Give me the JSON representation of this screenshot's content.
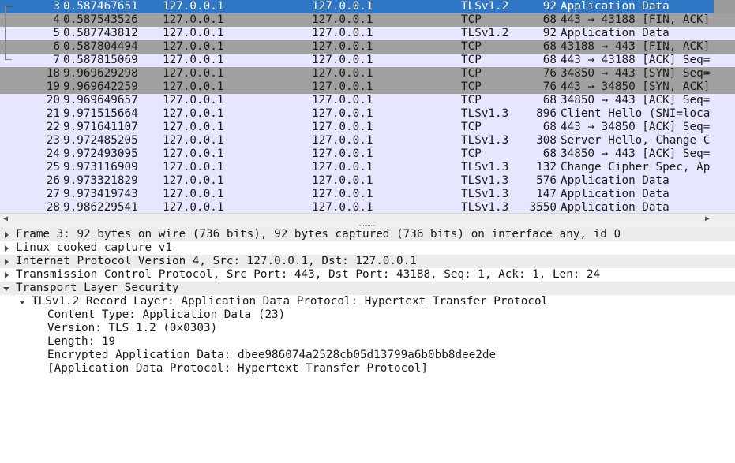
{
  "packet_list": {
    "rows": [
      {
        "no": "3",
        "time": "0.587467651",
        "src": "127.0.0.1",
        "dst": "127.0.0.1",
        "proto": "TLSv1.2",
        "len": "92",
        "info": "Application Data",
        "style": "sel"
      },
      {
        "no": "4",
        "time": "0.587543526",
        "src": "127.0.0.1",
        "dst": "127.0.0.1",
        "proto": "TCP",
        "len": "68",
        "info": "443 → 43188 [FIN, ACK]",
        "style": "fin"
      },
      {
        "no": "5",
        "time": "0.587743812",
        "src": "127.0.0.1",
        "dst": "127.0.0.1",
        "proto": "TLSv1.2",
        "len": "92",
        "info": "Application Data",
        "style": "tls"
      },
      {
        "no": "6",
        "time": "0.587804494",
        "src": "127.0.0.1",
        "dst": "127.0.0.1",
        "proto": "TCP",
        "len": "68",
        "info": "43188 → 443 [FIN, ACK]",
        "style": "fin"
      },
      {
        "no": "7",
        "time": "0.587815069",
        "src": "127.0.0.1",
        "dst": "127.0.0.1",
        "proto": "TCP",
        "len": "68",
        "info": "443 → 43188 [ACK] Seq=",
        "style": "tcp"
      },
      {
        "no": "18",
        "time": "9.969629298",
        "src": "127.0.0.1",
        "dst": "127.0.0.1",
        "proto": "TCP",
        "len": "76",
        "info": "34850 → 443 [SYN] Seq=",
        "style": "syn"
      },
      {
        "no": "19",
        "time": "9.969642259",
        "src": "127.0.0.1",
        "dst": "127.0.0.1",
        "proto": "TCP",
        "len": "76",
        "info": "443 → 34850 [SYN, ACK]",
        "style": "syn"
      },
      {
        "no": "20",
        "time": "9.969649657",
        "src": "127.0.0.1",
        "dst": "127.0.0.1",
        "proto": "TCP",
        "len": "68",
        "info": "34850 → 443 [ACK] Seq=",
        "style": "tcp"
      },
      {
        "no": "21",
        "time": "9.971515664",
        "src": "127.0.0.1",
        "dst": "127.0.0.1",
        "proto": "TLSv1.3",
        "len": "896",
        "info": "Client Hello (SNI=loca",
        "style": "tls"
      },
      {
        "no": "22",
        "time": "9.971641107",
        "src": "127.0.0.1",
        "dst": "127.0.0.1",
        "proto": "TCP",
        "len": "68",
        "info": "443 → 34850 [ACK] Seq=",
        "style": "tcp"
      },
      {
        "no": "23",
        "time": "9.972485205",
        "src": "127.0.0.1",
        "dst": "127.0.0.1",
        "proto": "TLSv1.3",
        "len": "308",
        "info": "Server Hello, Change C",
        "style": "tls"
      },
      {
        "no": "24",
        "time": "9.972493095",
        "src": "127.0.0.1",
        "dst": "127.0.0.1",
        "proto": "TCP",
        "len": "68",
        "info": "34850 → 443 [ACK] Seq=",
        "style": "tcp"
      },
      {
        "no": "25",
        "time": "9.973116909",
        "src": "127.0.0.1",
        "dst": "127.0.0.1",
        "proto": "TLSv1.3",
        "len": "132",
        "info": "Change Cipher Spec, Ap",
        "style": "tls"
      },
      {
        "no": "26",
        "time": "9.973321829",
        "src": "127.0.0.1",
        "dst": "127.0.0.1",
        "proto": "TLSv1.3",
        "len": "576",
        "info": "Application Data",
        "style": "tls"
      },
      {
        "no": "27",
        "time": "9.973419743",
        "src": "127.0.0.1",
        "dst": "127.0.0.1",
        "proto": "TLSv1.3",
        "len": "147",
        "info": "Application Data",
        "style": "tls"
      },
      {
        "no": "28",
        "time": "9.986229541",
        "src": "127.0.0.1",
        "dst": "127.0.0.1",
        "proto": "TLSv1.3",
        "len": "3550",
        "info": "Application Data",
        "style": "tls"
      }
    ]
  },
  "scrollbar": {
    "left_icon": "scroll-left-icon",
    "right_icon": "scroll-right-icon"
  },
  "colors": {
    "selected": "#2f76c5",
    "tcp_tls": "#e7e6ff",
    "fin_syn": "#a0a0a0",
    "detail_shade": "#ececec"
  },
  "details": {
    "items": [
      {
        "text": "Frame 3: 92 bytes on wire (736 bits), 92 bytes captured (736 bits) on interface any, id 0",
        "level": 0,
        "expander": "right",
        "shade": true
      },
      {
        "text": "Linux cooked capture v1",
        "level": 0,
        "expander": "right",
        "shade": false
      },
      {
        "text": "Internet Protocol Version 4, Src: 127.0.0.1, Dst: 127.0.0.1",
        "level": 0,
        "expander": "right",
        "shade": true
      },
      {
        "text": "Transmission Control Protocol, Src Port: 443, Dst Port: 43188, Seq: 1, Ack: 1, Len: 24",
        "level": 0,
        "expander": "right",
        "shade": false
      },
      {
        "text": "Transport Layer Security",
        "level": 0,
        "expander": "down",
        "shade": true
      },
      {
        "text": "TLSv1.2 Record Layer: Application Data Protocol: Hypertext Transfer Protocol",
        "level": 1,
        "expander": "down",
        "shade": false
      },
      {
        "text": "Content Type: Application Data (23)",
        "level": 2,
        "expander": "none",
        "shade": false
      },
      {
        "text": "Version: TLS 1.2 (0x0303)",
        "level": 2,
        "expander": "none",
        "shade": false
      },
      {
        "text": "Length: 19",
        "level": 2,
        "expander": "none",
        "shade": false
      },
      {
        "text": "Encrypted Application Data: dbee986074a2528cb05d13799a6b0bb8dee2de",
        "level": 2,
        "expander": "none",
        "shade": false
      },
      {
        "text": "[Application Data Protocol: Hypertext Transfer Protocol]",
        "level": 2,
        "expander": "none",
        "shade": false
      }
    ]
  }
}
